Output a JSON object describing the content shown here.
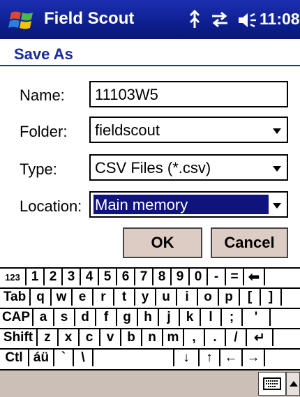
{
  "titlebar": {
    "app_title": "Field Scout",
    "clock": "11:08",
    "icons": [
      "windows-start-icon",
      "signal-icon",
      "connectivity-icon",
      "volume-icon"
    ]
  },
  "header": {
    "title": "Save As"
  },
  "form": {
    "name_label": "Name:",
    "name_value": "11103W5",
    "folder_label": "Folder:",
    "folder_value": "fieldscout",
    "type_label": "Type:",
    "type_value": "CSV Files (*.csv)",
    "location_label": "Location:",
    "location_value": "Main memory"
  },
  "buttons": {
    "ok": "OK",
    "cancel": "Cancel"
  },
  "keyboard": {
    "rows": [
      [
        "123",
        "1",
        "2",
        "3",
        "4",
        "5",
        "6",
        "7",
        "8",
        "9",
        "0",
        "-",
        "=",
        "⬅"
      ],
      [
        "Tab",
        "q",
        "w",
        "e",
        "r",
        "t",
        "y",
        "u",
        "i",
        "o",
        "p",
        "[",
        "]"
      ],
      [
        "CAP",
        "a",
        "s",
        "d",
        "f",
        "g",
        "h",
        "j",
        "k",
        "l",
        ";",
        "'"
      ],
      [
        "Shift",
        "z",
        "x",
        "c",
        "v",
        "b",
        "n",
        "m",
        ",",
        ".",
        "/",
        "↵"
      ],
      [
        "Ctl",
        "áü",
        "`",
        "\\",
        " ",
        "↓",
        "↑",
        "←",
        "→"
      ]
    ]
  },
  "colors": {
    "titlebar": "#0d1f8f",
    "header_text": "#1a2a9a",
    "selection": "#0e137e",
    "button_bg": "#ddccc4",
    "bottombar": "#ccbfb8"
  }
}
